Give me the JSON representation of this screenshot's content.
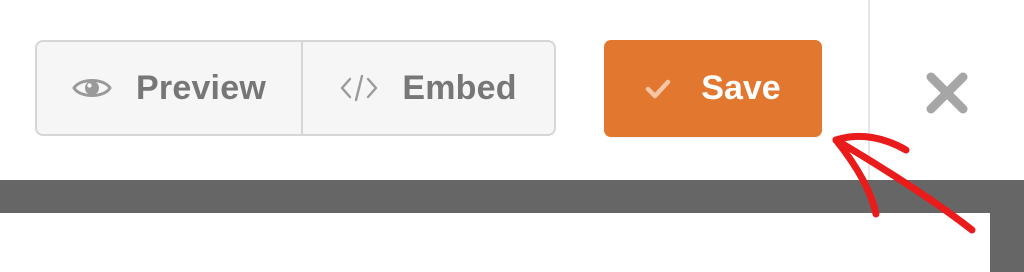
{
  "toolbar": {
    "preview_label": "Preview",
    "embed_label": "Embed",
    "save_label": "Save"
  },
  "icons": {
    "preview": "eye-icon",
    "embed": "code-icon",
    "save": "checkmark-icon",
    "close": "close-icon"
  },
  "colors": {
    "save_bg": "#e27730",
    "save_text": "#ffffff",
    "segment_bg": "#f6f6f6",
    "segment_text": "#777777",
    "close_icon": "#a6a6a6",
    "dark_frame": "#666666",
    "annotation": "#ea1b1b"
  }
}
